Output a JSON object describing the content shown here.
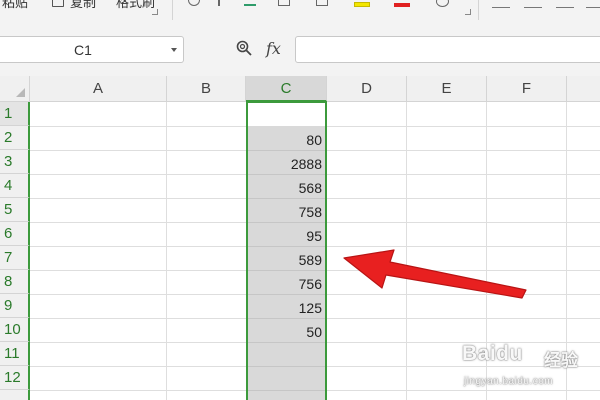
{
  "ribbon": {
    "paste_label": "粘贴",
    "copy_label": "复制",
    "format_painter_label": "格式刷"
  },
  "formula_bar": {
    "name_box_value": "C1",
    "fx_label": "fx",
    "formula_value": ""
  },
  "grid": {
    "columns": [
      "A",
      "B",
      "C",
      "D",
      "E",
      "F"
    ],
    "selected_column": "C",
    "rows": [
      "1",
      "2",
      "3",
      "4",
      "5",
      "6",
      "7",
      "8",
      "9",
      "10",
      "11",
      "12"
    ],
    "column_c_values": [
      "",
      "80",
      "2888",
      "568",
      "758",
      "95",
      "589",
      "756",
      "125",
      "50",
      "",
      ""
    ]
  },
  "annotation": {
    "arrow_color": "#e82020"
  },
  "watermark": {
    "brand": "Baidu",
    "product": "经验",
    "url": "jingyan.baidu.com"
  },
  "colors": {
    "selection_green": "#3c9a3c",
    "selected_fill": "#d9d9d9",
    "header_bg": "#f0f0f0"
  }
}
